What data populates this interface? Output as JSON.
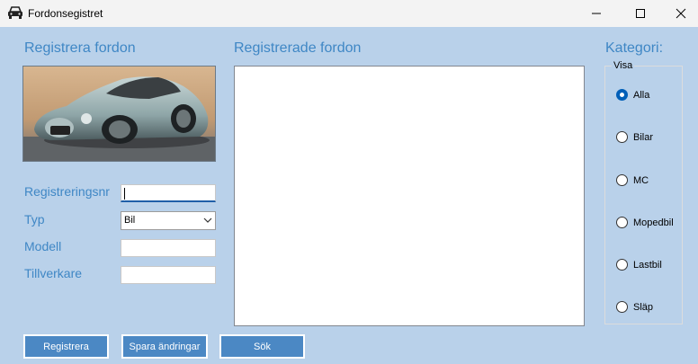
{
  "window": {
    "title": "Fordonsegistret"
  },
  "register_panel": {
    "heading": "Registrera fordon",
    "image_label": "car-photo",
    "fields": {
      "regnr_label": "Registreringsnr",
      "regnr_value": "",
      "typ_label": "Typ",
      "typ_value": "Bil",
      "modell_label": "Modell",
      "modell_value": "",
      "tillverkare_label": "Tillverkare",
      "tillverkare_value": ""
    }
  },
  "list_panel": {
    "heading": "Registrerade fordon",
    "items": []
  },
  "category_panel": {
    "heading": "Kategori:",
    "group_label": "Visa",
    "options": [
      "Alla",
      "Bilar",
      "MC",
      "Mopedbil",
      "Lastbil",
      "Släp"
    ],
    "selected": "Alla"
  },
  "buttons": {
    "registrera": "Registrera",
    "spara": "Spara ändringar",
    "sok": "Sök"
  },
  "colors": {
    "accent": "#3f87c5",
    "background": "#b9d1ea",
    "button": "#4b88c4"
  }
}
